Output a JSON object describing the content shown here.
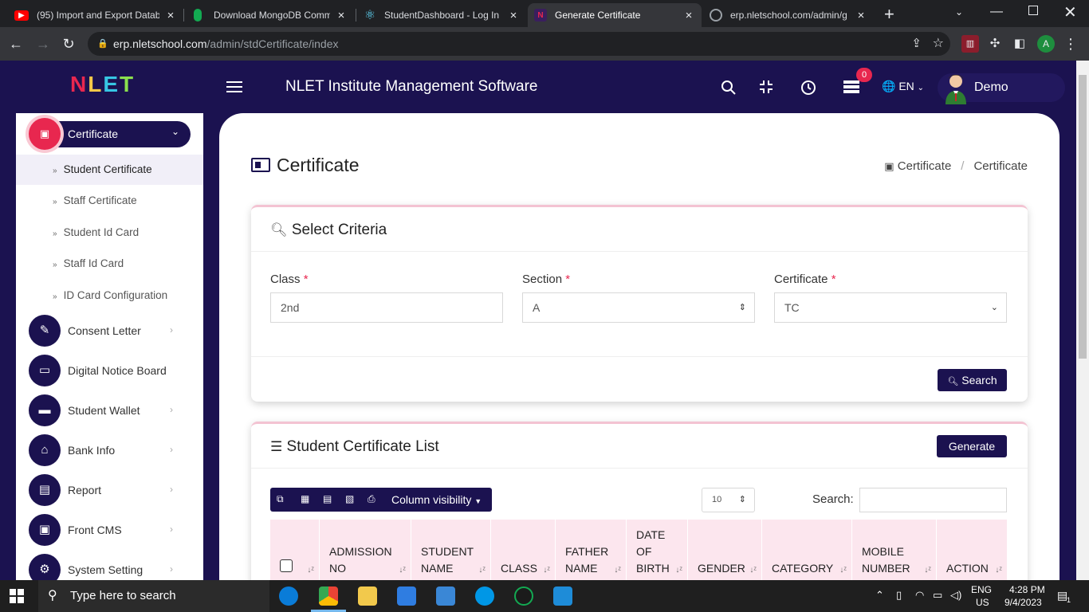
{
  "browser": {
    "tabs": [
      {
        "title": "(95) Import and Export Datab",
        "icon": "youtube-icon",
        "color": "#ff0000"
      },
      {
        "title": "Download MongoDB Comma",
        "icon": "mongodb-icon",
        "color": "#13aa52"
      },
      {
        "title": "StudentDashboard - Log In P",
        "icon": "react-icon",
        "color": "#61dafb"
      },
      {
        "title": "Generate Certificate",
        "icon": "nlet-icon",
        "color": "#e8274f"
      },
      {
        "title": "erp.nletschool.com/admin/g",
        "icon": "globe-icon",
        "color": "#9aa0a6"
      }
    ],
    "url_domain": "erp.nletschool.com",
    "url_path": "/admin/stdCertificate/index",
    "profile_letter": "A"
  },
  "header": {
    "logo": "NLET",
    "app_name": "NLET Institute Management Software",
    "notification_count": "0",
    "language": "EN",
    "user_name": "Demo"
  },
  "sidebar": {
    "active": "Certificate",
    "subitems": [
      "Student Certificate",
      "Staff Certificate",
      "Student Id Card",
      "Staff Id Card",
      "ID Card Configuration"
    ],
    "items": [
      {
        "label": "Consent Letter",
        "icon": "pen-icon",
        "chevron": true
      },
      {
        "label": "Digital Notice Board",
        "icon": "monitor-icon",
        "chevron": false
      },
      {
        "label": "Student Wallet",
        "icon": "wallet-icon",
        "chevron": true
      },
      {
        "label": "Bank Info",
        "icon": "bank-icon",
        "chevron": true
      },
      {
        "label": "Report",
        "icon": "report-icon",
        "chevron": true
      },
      {
        "label": "Front CMS",
        "icon": "cms-icon",
        "chevron": true
      },
      {
        "label": "System Setting",
        "icon": "gear-icon",
        "chevron": true
      }
    ]
  },
  "page": {
    "title": "Certificate",
    "breadcrumb": [
      "Certificate",
      "Certificate"
    ]
  },
  "criteria": {
    "title": "Select Criteria",
    "class_label": "Class",
    "class_value": "2nd",
    "section_label": "Section",
    "section_value": "A",
    "certificate_label": "Certificate",
    "certificate_value": "TC",
    "required_mark": "*",
    "search_button": "Search"
  },
  "list": {
    "title": "Student Certificate List",
    "generate_button": "Generate",
    "column_visibility": "Column visibility",
    "page_length": "10",
    "search_label": "Search:",
    "columns": [
      "ADMISSION NO",
      "STUDENT NAME",
      "CLASS",
      "FATHER NAME",
      "DATE OF BIRTH",
      "GENDER",
      "CATEGORY",
      "MOBILE NUMBER",
      "ACTION"
    ]
  },
  "taskbar": {
    "search_placeholder": "Type here to search",
    "lang_top": "ENG",
    "lang_bottom": "US",
    "time": "4:28 PM",
    "date": "9/4/2023",
    "notif": "1"
  }
}
